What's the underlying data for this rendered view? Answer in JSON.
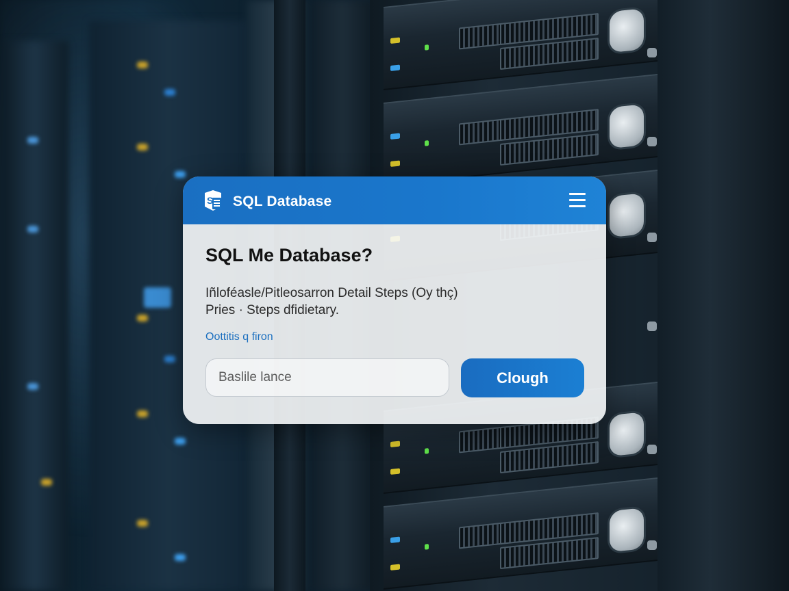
{
  "window": {
    "title": "SQL Database",
    "app_icon": "sql-database-icon",
    "menu_icon": "hamburger-menu-icon"
  },
  "content": {
    "heading": "SQL Me Database?",
    "description_line1": "Iñloféasle/Pitleosarron Detail Steps (Oy thç)",
    "description_line2": "Pries · Steps dfidietary.",
    "link_text": "Oottitis q firon"
  },
  "form": {
    "input_placeholder": "Baslile lance",
    "input_value": "",
    "submit_label": "Clough"
  },
  "colors": {
    "accent": "#1a72c5",
    "titlebar_start": "#1a6fc2",
    "titlebar_end": "#1f83d6",
    "link": "#1b6fbf"
  }
}
